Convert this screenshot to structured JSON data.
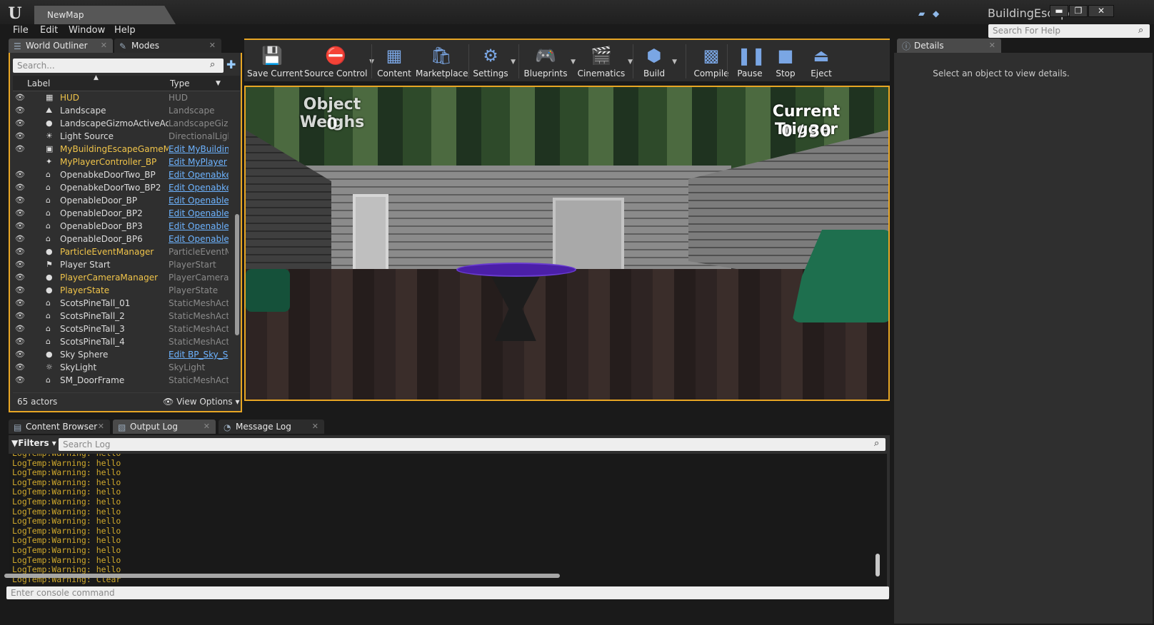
{
  "title_bar": {
    "map_tab": "NewMap",
    "project": "BuildingEscape",
    "minimize": "▬",
    "restore": "❐",
    "close": "✕"
  },
  "menu": [
    "File",
    "Edit",
    "Window",
    "Help"
  ],
  "help_search_placeholder": "Search For Help",
  "panel_tabs": {
    "world_outliner": "World Outliner",
    "modes": "Modes",
    "details": "Details",
    "content_browser": "Content Browser",
    "output_log": "Output Log",
    "message_log": "Message Log"
  },
  "outliner": {
    "search_placeholder": "Search...",
    "col_label": "Label",
    "col_type": "Type",
    "rows": [
      {
        "label": "HUD",
        "type": "HUD",
        "yellow": true,
        "link": false,
        "icon": "hud-icon"
      },
      {
        "label": "Landscape",
        "type": "Landscape",
        "yellow": false,
        "link": false,
        "icon": "landscape-icon"
      },
      {
        "label": "LandscapeGizmoActiveActor",
        "type": "LandscapeGizm",
        "yellow": false,
        "link": false,
        "icon": "gizmo-icon"
      },
      {
        "label": "Light Source",
        "type": "DirectionalLigh",
        "yellow": false,
        "link": false,
        "icon": "light-icon"
      },
      {
        "label": "MyBuildingEscapeGameMode",
        "type": "Edit MyBuildin",
        "yellow": true,
        "link": true,
        "icon": "gamemode-icon"
      },
      {
        "label": "MyPlayerController_BP",
        "type": "Edit MyPlayer",
        "yellow": true,
        "link": true,
        "icon": "controller-icon"
      },
      {
        "label": "OpenabkeDoorTwo_BP",
        "type": "Edit Openabke",
        "yellow": false,
        "link": true,
        "icon": "actor-icon"
      },
      {
        "label": "OpenabkeDoorTwo_BP2",
        "type": "Edit Openabke",
        "yellow": false,
        "link": true,
        "icon": "actor-icon"
      },
      {
        "label": "OpenableDoor_BP",
        "type": "Edit Openable",
        "yellow": false,
        "link": true,
        "icon": "actor-icon"
      },
      {
        "label": "OpenableDoor_BP2",
        "type": "Edit Openable",
        "yellow": false,
        "link": true,
        "icon": "actor-icon"
      },
      {
        "label": "OpenableDoor_BP3",
        "type": "Edit Openable",
        "yellow": false,
        "link": true,
        "icon": "actor-icon"
      },
      {
        "label": "OpenableDoor_BP6",
        "type": "Edit Openable",
        "yellow": false,
        "link": true,
        "icon": "actor-icon"
      },
      {
        "label": "ParticleEventManager",
        "type": "ParticleEventMa",
        "yellow": true,
        "link": false,
        "icon": "sphere-icon"
      },
      {
        "label": "Player Start",
        "type": "PlayerStart",
        "yellow": false,
        "link": false,
        "icon": "playerstart-icon"
      },
      {
        "label": "PlayerCameraManager",
        "type": "PlayerCameraM",
        "yellow": true,
        "link": false,
        "icon": "camera-icon"
      },
      {
        "label": "PlayerState",
        "type": "PlayerState",
        "yellow": true,
        "link": false,
        "icon": "sphere-icon"
      },
      {
        "label": "ScotsPineTall_01",
        "type": "StaticMeshActo",
        "yellow": false,
        "link": false,
        "icon": "mesh-icon"
      },
      {
        "label": "ScotsPineTall_2",
        "type": "StaticMeshActo",
        "yellow": false,
        "link": false,
        "icon": "mesh-icon"
      },
      {
        "label": "ScotsPineTall_3",
        "type": "StaticMeshActo",
        "yellow": false,
        "link": false,
        "icon": "mesh-icon"
      },
      {
        "label": "ScotsPineTall_4",
        "type": "StaticMeshActo",
        "yellow": false,
        "link": false,
        "icon": "mesh-icon"
      },
      {
        "label": "Sky Sphere",
        "type": "Edit BP_Sky_S",
        "yellow": false,
        "link": true,
        "icon": "sphere-icon"
      },
      {
        "label": "SkyLight",
        "type": "SkyLight",
        "yellow": false,
        "link": false,
        "icon": "skylight-icon"
      },
      {
        "label": "SM_DoorFrame",
        "type": "StaticMeshActo",
        "yellow": false,
        "link": false,
        "icon": "mesh-icon"
      }
    ],
    "actor_count": "65 actors",
    "view_options": "View Options"
  },
  "toolbar": [
    {
      "label": "Save Current",
      "icon": "save-icon",
      "glyph": "💾"
    },
    {
      "label": "Source Control",
      "icon": "source-control-icon",
      "glyph": "⛔"
    },
    {
      "label": "Content",
      "icon": "content-icon",
      "glyph": "▦"
    },
    {
      "label": "Marketplace",
      "icon": "marketplace-icon",
      "glyph": "🛍"
    },
    {
      "label": "Settings",
      "icon": "settings-icon",
      "glyph": "⚙"
    },
    {
      "label": "Blueprints",
      "icon": "blueprints-icon",
      "glyph": "🎮"
    },
    {
      "label": "Cinematics",
      "icon": "cinematics-icon",
      "glyph": "🎬"
    },
    {
      "label": "Build",
      "icon": "build-icon",
      "glyph": "⬢"
    },
    {
      "label": "Compile",
      "icon": "compile-icon",
      "glyph": "▩"
    },
    {
      "label": "Pause",
      "icon": "pause-icon",
      "glyph": "❚❚"
    },
    {
      "label": "Stop",
      "icon": "stop-icon",
      "glyph": "■"
    },
    {
      "label": "Eject",
      "icon": "eject-icon",
      "glyph": "⏏"
    }
  ],
  "viewport": {
    "object_weighs_label": "Object Weighs",
    "object_weighs_value": "0",
    "trigger_label": "Current Trigger",
    "trigger_value": "0 / 30"
  },
  "details_message": "Select an object to view details.",
  "output_log": {
    "filters": "Filters",
    "search_placeholder": "Search Log",
    "lines": [
      "LogTemp:Warning: hello",
      "LogTemp:Warning: hello",
      "LogTemp:Warning: hello",
      "LogTemp:Warning: hello",
      "LogTemp:Warning: hello",
      "LogTemp:Warning: hello",
      "LogTemp:Warning: hello",
      "LogTemp:Warning: hello",
      "LogTemp:Warning: hello",
      "LogTemp:Warning: hello",
      "LogTemp:Warning: hello",
      "LogTemp:Warning: hello",
      "LogTemp:Warning: hello",
      "LogTemp:Warning: Clear"
    ]
  },
  "console_placeholder": "Enter console command",
  "colors": {
    "accent": "#e8a624",
    "link": "#6db3ff",
    "yellow_label": "#f0c44a",
    "log_text": "#cfa82c"
  }
}
